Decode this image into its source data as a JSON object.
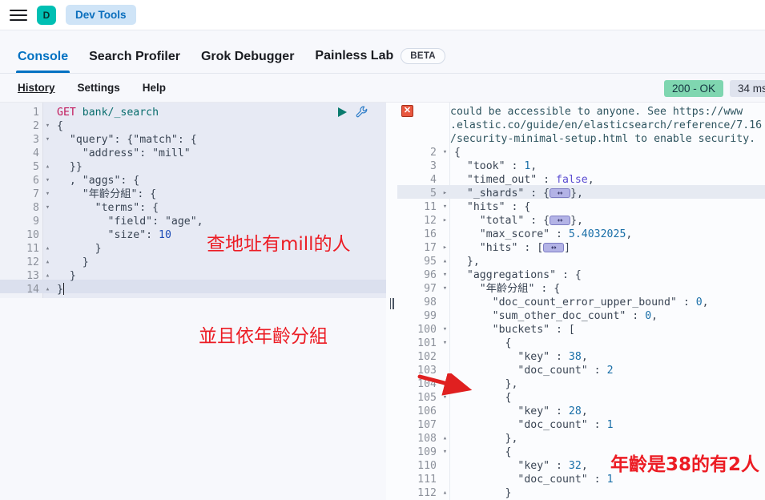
{
  "chrome": {
    "menu_icon": "hamburger-icon",
    "avatar_initial": "D",
    "breadcrumb": "Dev Tools"
  },
  "tabs": [
    {
      "label": "Console",
      "active": true
    },
    {
      "label": "Search Profiler",
      "active": false
    },
    {
      "label": "Grok Debugger",
      "active": false
    },
    {
      "label": "Painless Lab",
      "active": false,
      "badge": "BETA"
    }
  ],
  "subbar": {
    "links": [
      "History",
      "Settings",
      "Help"
    ],
    "status_code": "200 - OK",
    "status_time": "34 ms"
  },
  "editor": {
    "run_icon": "play-icon",
    "wrench_icon": "wrench-icon",
    "lines": [
      {
        "num": "1",
        "fold": "",
        "text": "GET bank/_search"
      },
      {
        "num": "2",
        "fold": "▾",
        "text": "{"
      },
      {
        "num": "3",
        "fold": "▾",
        "text": "  \"query\": {\"match\": {"
      },
      {
        "num": "4",
        "fold": "",
        "text": "    \"address\": \"mill\""
      },
      {
        "num": "5",
        "fold": "▴",
        "text": "  }}"
      },
      {
        "num": "6",
        "fold": "▾",
        "text": "  , \"aggs\": {"
      },
      {
        "num": "7",
        "fold": "▾",
        "text": "    \"年齡分組\": {"
      },
      {
        "num": "8",
        "fold": "▾",
        "text": "      \"terms\": {"
      },
      {
        "num": "9",
        "fold": "",
        "text": "        \"field\": \"age\","
      },
      {
        "num": "10",
        "fold": "",
        "text": "        \"size\": 10"
      },
      {
        "num": "11",
        "fold": "▴",
        "text": "      }"
      },
      {
        "num": "12",
        "fold": "▴",
        "text": "    }"
      },
      {
        "num": "13",
        "fold": "▴",
        "text": "  }"
      },
      {
        "num": "14",
        "fold": "▴",
        "text": "}"
      }
    ]
  },
  "response": {
    "error_marker": "error-icon",
    "warning_lines": [
      "could be accessible to anyone. See https://www",
      ".elastic.co/guide/en/elasticsearch/reference/7.16",
      "/security-minimal-setup.html to enable security."
    ],
    "lines": [
      {
        "num": "2",
        "fold": "▾",
        "text": "{"
      },
      {
        "num": "3",
        "fold": "",
        "text": "  \"took\" : 1,"
      },
      {
        "num": "4",
        "fold": "",
        "text": "  \"timed_out\" : false,"
      },
      {
        "num": "5",
        "fold": "▸",
        "text": "  \"_shards\" : {↔},"
      },
      {
        "num": "11",
        "fold": "▾",
        "text": "  \"hits\" : {"
      },
      {
        "num": "12",
        "fold": "▸",
        "text": "    \"total\" : {↔},"
      },
      {
        "num": "16",
        "fold": "",
        "text": "    \"max_score\" : 5.4032025,"
      },
      {
        "num": "17",
        "fold": "▸",
        "text": "    \"hits\" : [↔]"
      },
      {
        "num": "95",
        "fold": "▴",
        "text": "  },"
      },
      {
        "num": "96",
        "fold": "▾",
        "text": "  \"aggregations\" : {"
      },
      {
        "num": "97",
        "fold": "▾",
        "text": "    \"年齡分組\" : {"
      },
      {
        "num": "98",
        "fold": "",
        "text": "      \"doc_count_error_upper_bound\" : 0,"
      },
      {
        "num": "99",
        "fold": "",
        "text": "      \"sum_other_doc_count\" : 0,"
      },
      {
        "num": "100",
        "fold": "▾",
        "text": "      \"buckets\" : ["
      },
      {
        "num": "101",
        "fold": "▾",
        "text": "        {"
      },
      {
        "num": "102",
        "fold": "",
        "text": "          \"key\" : 38,"
      },
      {
        "num": "103",
        "fold": "",
        "text": "          \"doc_count\" : 2"
      },
      {
        "num": "104",
        "fold": "▴",
        "text": "        },"
      },
      {
        "num": "105",
        "fold": "▾",
        "text": "        {"
      },
      {
        "num": "106",
        "fold": "",
        "text": "          \"key\" : 28,"
      },
      {
        "num": "107",
        "fold": "",
        "text": "          \"doc_count\" : 1"
      },
      {
        "num": "108",
        "fold": "▴",
        "text": "        },"
      },
      {
        "num": "109",
        "fold": "▾",
        "text": "        {"
      },
      {
        "num": "110",
        "fold": "",
        "text": "          \"key\" : 32,"
      },
      {
        "num": "111",
        "fold": "",
        "text": "          \"doc_count\" : 1"
      },
      {
        "num": "112",
        "fold": "▴",
        "text": "        }"
      }
    ]
  },
  "annotations": {
    "query_note": "查地址有mill的人",
    "group_note": "並且依年齡分組",
    "age_note": "年齡是38的有2人",
    "color": "#ec1c24"
  },
  "colors": {
    "accent": "#0071c2",
    "avatar": "#00bfb3",
    "status_ok": "#7fd6b0",
    "annotation_red": "#ec1c24"
  }
}
